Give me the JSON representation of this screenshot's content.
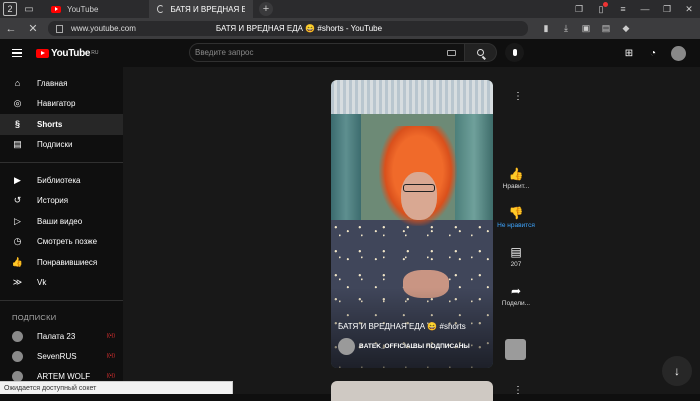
{
  "browser": {
    "tab_count": "2",
    "tabs": [
      {
        "label": "YouTube",
        "active": false
      },
      {
        "label": "БАТЯ И ВРЕДНАЯ ЕДА 😄 #sh",
        "active": true
      }
    ],
    "url": "www.youtube.com",
    "page_title": "БАТЯ И ВРЕДНАЯ ЕДА 😄 #shorts - YouTube",
    "status_text": "Ожидается доступный сокет"
  },
  "header": {
    "logo_text": "YouTube",
    "region": "RU",
    "search_placeholder": "Введите запрос"
  },
  "sidebar": {
    "items": [
      {
        "label": "Главная",
        "icon": "home-icon"
      },
      {
        "label": "Навигатор",
        "icon": "compass-icon"
      },
      {
        "label": "Shorts",
        "icon": "shorts-icon",
        "active": true
      },
      {
        "label": "Подписки",
        "icon": "subscriptions-icon"
      },
      {
        "label": "Библиотека",
        "icon": "library-icon"
      },
      {
        "label": "История",
        "icon": "history-icon"
      },
      {
        "label": "Ваши видео",
        "icon": "your-videos-icon"
      },
      {
        "label": "Смотреть позже",
        "icon": "watch-later-icon"
      },
      {
        "label": "Понравившиеся",
        "icon": "liked-icon"
      },
      {
        "label": "Vk",
        "icon": "chevron-icon"
      }
    ],
    "subs_heading": "ПОДПИСКИ",
    "subscriptions": [
      {
        "name": "Палата 23"
      },
      {
        "name": "SevenRUS"
      },
      {
        "name": "ARTEM WOLF"
      }
    ]
  },
  "short": {
    "title": "БАТЯ И ВРЕДНАЯ ЕДА 😄 #shorts",
    "channel": "BATEK_OFFICIAL",
    "subscribe_label": "ВЫ ПОДПИСАНЫ",
    "actions": {
      "like": "Нравит...",
      "dislike": "Не нравится",
      "comments": "207",
      "share": "Подели..."
    }
  },
  "colors": {
    "accent": "#ff0000",
    "dislike_active": "#3ea6ff",
    "background": "#0f0f0f"
  }
}
